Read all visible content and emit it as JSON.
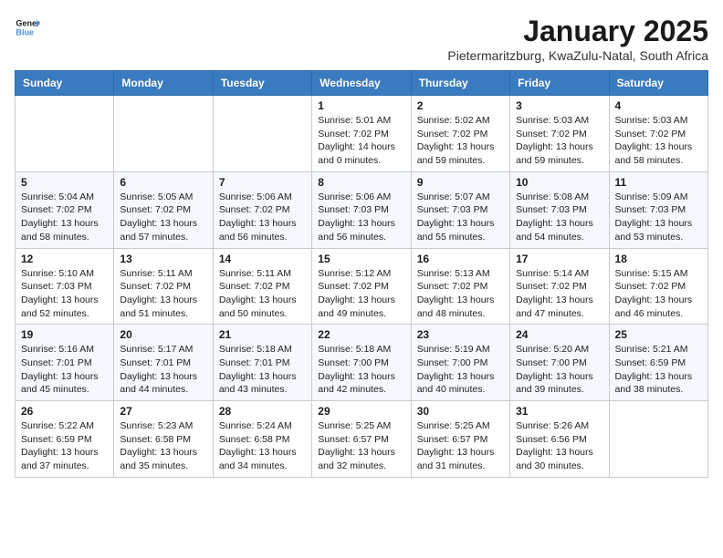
{
  "logo": {
    "line1": "General",
    "line2": "Blue"
  },
  "title": "January 2025",
  "subtitle": "Pietermaritzburg, KwaZulu-Natal, South Africa",
  "weekdays": [
    "Sunday",
    "Monday",
    "Tuesday",
    "Wednesday",
    "Thursday",
    "Friday",
    "Saturday"
  ],
  "weeks": [
    [
      {
        "day": "",
        "info": ""
      },
      {
        "day": "",
        "info": ""
      },
      {
        "day": "",
        "info": ""
      },
      {
        "day": "1",
        "info": "Sunrise: 5:01 AM\nSunset: 7:02 PM\nDaylight: 14 hours\nand 0 minutes."
      },
      {
        "day": "2",
        "info": "Sunrise: 5:02 AM\nSunset: 7:02 PM\nDaylight: 13 hours\nand 59 minutes."
      },
      {
        "day": "3",
        "info": "Sunrise: 5:03 AM\nSunset: 7:02 PM\nDaylight: 13 hours\nand 59 minutes."
      },
      {
        "day": "4",
        "info": "Sunrise: 5:03 AM\nSunset: 7:02 PM\nDaylight: 13 hours\nand 58 minutes."
      }
    ],
    [
      {
        "day": "5",
        "info": "Sunrise: 5:04 AM\nSunset: 7:02 PM\nDaylight: 13 hours\nand 58 minutes."
      },
      {
        "day": "6",
        "info": "Sunrise: 5:05 AM\nSunset: 7:02 PM\nDaylight: 13 hours\nand 57 minutes."
      },
      {
        "day": "7",
        "info": "Sunrise: 5:06 AM\nSunset: 7:02 PM\nDaylight: 13 hours\nand 56 minutes."
      },
      {
        "day": "8",
        "info": "Sunrise: 5:06 AM\nSunset: 7:03 PM\nDaylight: 13 hours\nand 56 minutes."
      },
      {
        "day": "9",
        "info": "Sunrise: 5:07 AM\nSunset: 7:03 PM\nDaylight: 13 hours\nand 55 minutes."
      },
      {
        "day": "10",
        "info": "Sunrise: 5:08 AM\nSunset: 7:03 PM\nDaylight: 13 hours\nand 54 minutes."
      },
      {
        "day": "11",
        "info": "Sunrise: 5:09 AM\nSunset: 7:03 PM\nDaylight: 13 hours\nand 53 minutes."
      }
    ],
    [
      {
        "day": "12",
        "info": "Sunrise: 5:10 AM\nSunset: 7:03 PM\nDaylight: 13 hours\nand 52 minutes."
      },
      {
        "day": "13",
        "info": "Sunrise: 5:11 AM\nSunset: 7:02 PM\nDaylight: 13 hours\nand 51 minutes."
      },
      {
        "day": "14",
        "info": "Sunrise: 5:11 AM\nSunset: 7:02 PM\nDaylight: 13 hours\nand 50 minutes."
      },
      {
        "day": "15",
        "info": "Sunrise: 5:12 AM\nSunset: 7:02 PM\nDaylight: 13 hours\nand 49 minutes."
      },
      {
        "day": "16",
        "info": "Sunrise: 5:13 AM\nSunset: 7:02 PM\nDaylight: 13 hours\nand 48 minutes."
      },
      {
        "day": "17",
        "info": "Sunrise: 5:14 AM\nSunset: 7:02 PM\nDaylight: 13 hours\nand 47 minutes."
      },
      {
        "day": "18",
        "info": "Sunrise: 5:15 AM\nSunset: 7:02 PM\nDaylight: 13 hours\nand 46 minutes."
      }
    ],
    [
      {
        "day": "19",
        "info": "Sunrise: 5:16 AM\nSunset: 7:01 PM\nDaylight: 13 hours\nand 45 minutes."
      },
      {
        "day": "20",
        "info": "Sunrise: 5:17 AM\nSunset: 7:01 PM\nDaylight: 13 hours\nand 44 minutes."
      },
      {
        "day": "21",
        "info": "Sunrise: 5:18 AM\nSunset: 7:01 PM\nDaylight: 13 hours\nand 43 minutes."
      },
      {
        "day": "22",
        "info": "Sunrise: 5:18 AM\nSunset: 7:00 PM\nDaylight: 13 hours\nand 42 minutes."
      },
      {
        "day": "23",
        "info": "Sunrise: 5:19 AM\nSunset: 7:00 PM\nDaylight: 13 hours\nand 40 minutes."
      },
      {
        "day": "24",
        "info": "Sunrise: 5:20 AM\nSunset: 7:00 PM\nDaylight: 13 hours\nand 39 minutes."
      },
      {
        "day": "25",
        "info": "Sunrise: 5:21 AM\nSunset: 6:59 PM\nDaylight: 13 hours\nand 38 minutes."
      }
    ],
    [
      {
        "day": "26",
        "info": "Sunrise: 5:22 AM\nSunset: 6:59 PM\nDaylight: 13 hours\nand 37 minutes."
      },
      {
        "day": "27",
        "info": "Sunrise: 5:23 AM\nSunset: 6:58 PM\nDaylight: 13 hours\nand 35 minutes."
      },
      {
        "day": "28",
        "info": "Sunrise: 5:24 AM\nSunset: 6:58 PM\nDaylight: 13 hours\nand 34 minutes."
      },
      {
        "day": "29",
        "info": "Sunrise: 5:25 AM\nSunset: 6:57 PM\nDaylight: 13 hours\nand 32 minutes."
      },
      {
        "day": "30",
        "info": "Sunrise: 5:25 AM\nSunset: 6:57 PM\nDaylight: 13 hours\nand 31 minutes."
      },
      {
        "day": "31",
        "info": "Sunrise: 5:26 AM\nSunset: 6:56 PM\nDaylight: 13 hours\nand 30 minutes."
      },
      {
        "day": "",
        "info": ""
      }
    ]
  ]
}
